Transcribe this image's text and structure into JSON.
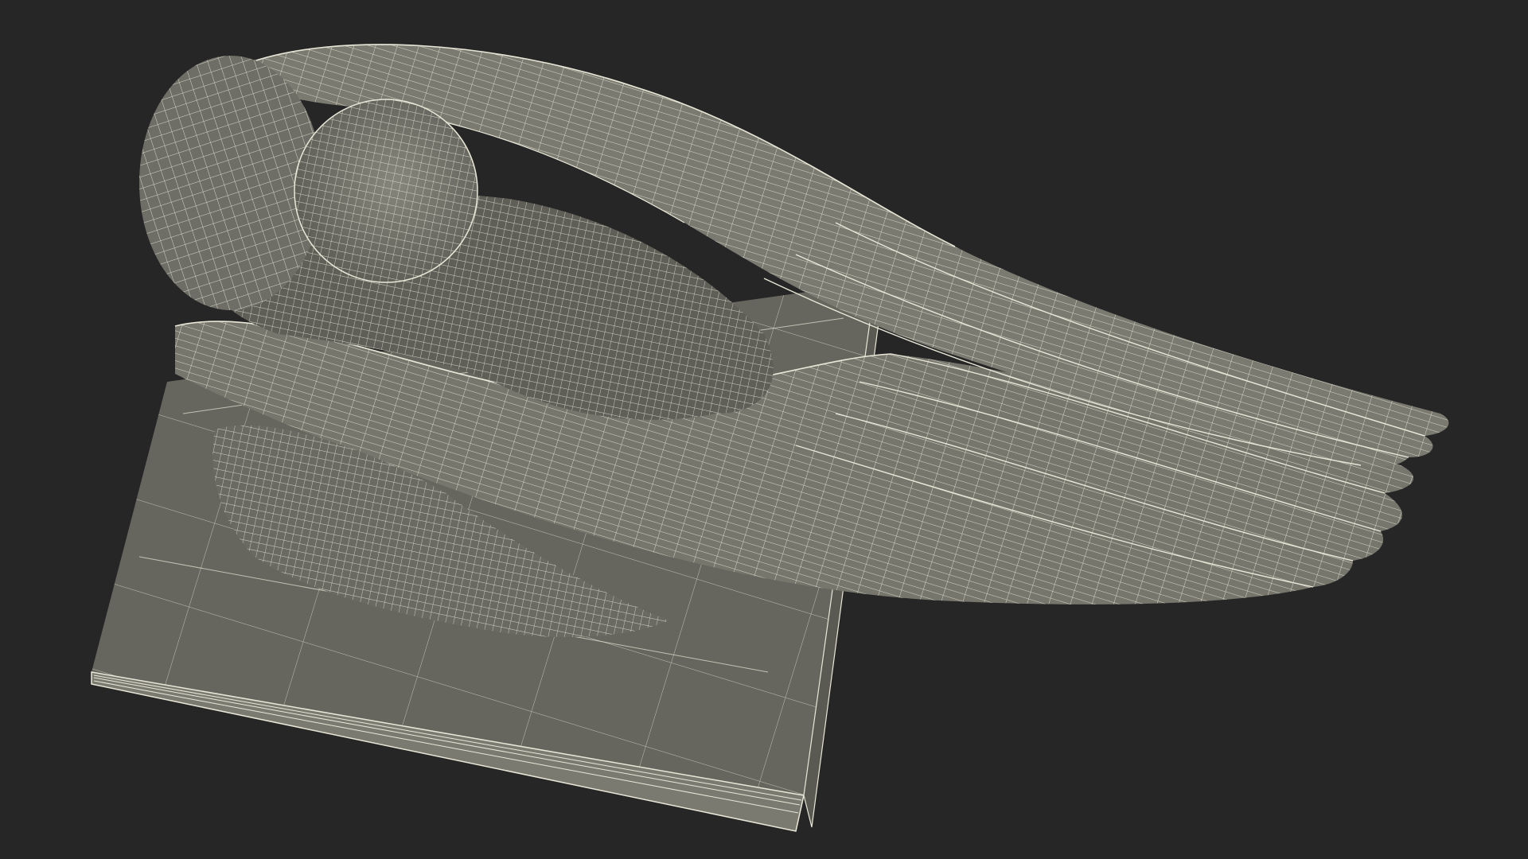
{
  "scene": {
    "subject": "wireframe-render",
    "colors": {
      "background": "#262626",
      "surface": "#6f6f66",
      "surface_dark": "#55554e",
      "surface_light": "#84847a",
      "wire": "#e9e8d8",
      "shadow": "#3c3c37"
    }
  }
}
